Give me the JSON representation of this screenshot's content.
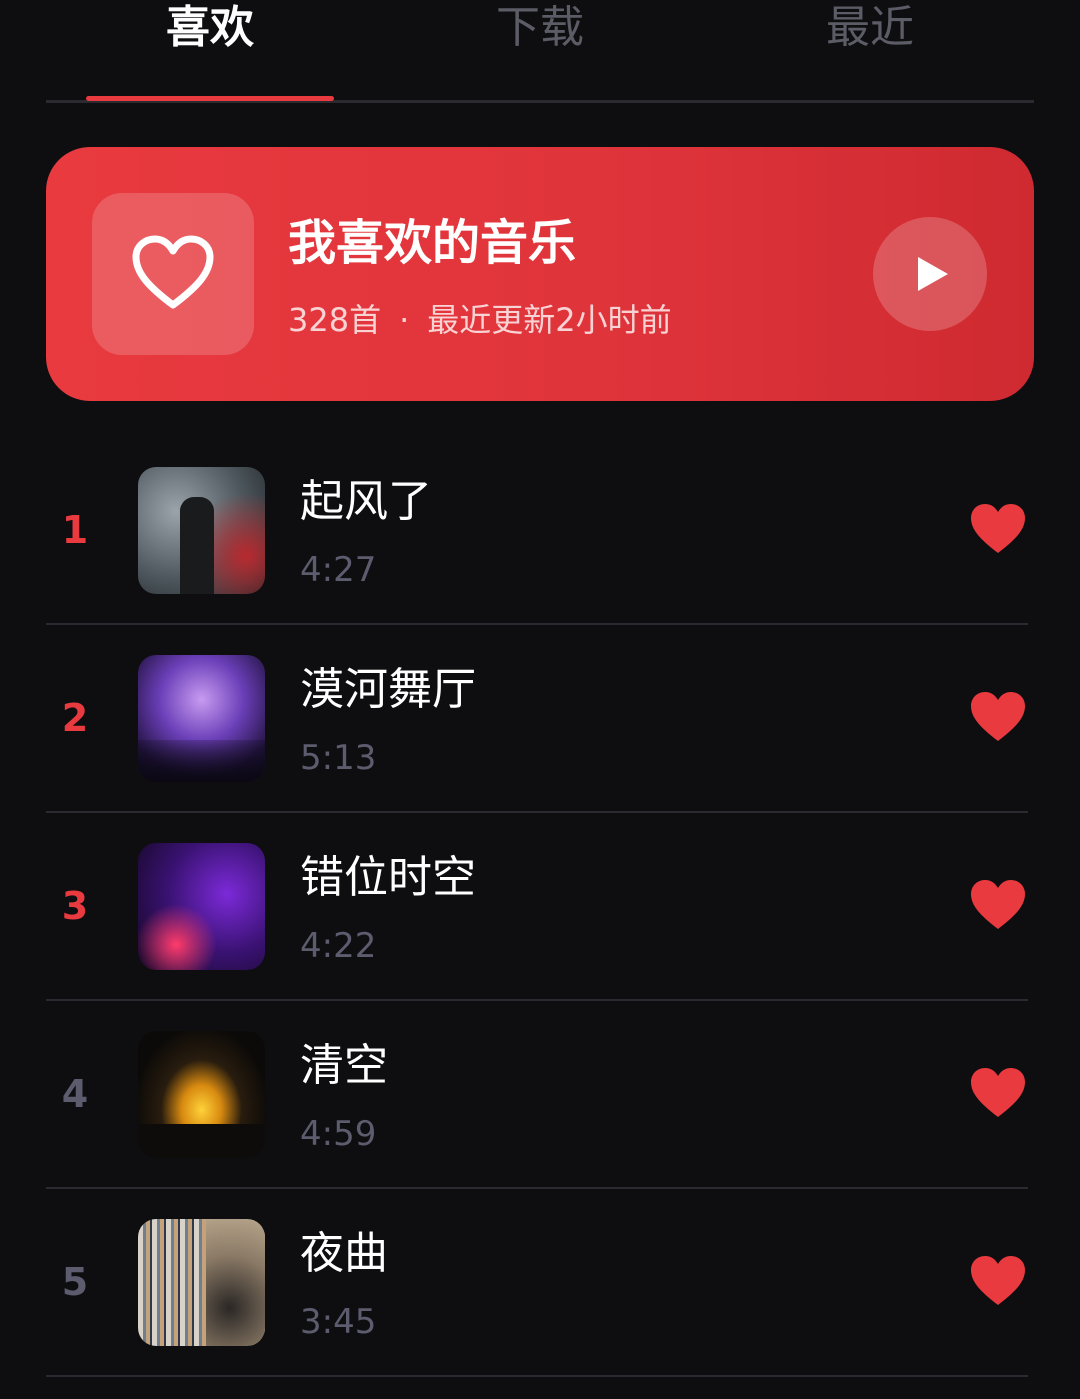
{
  "tabs": [
    {
      "label": "喜欢",
      "active": true
    },
    {
      "label": "下载",
      "active": false
    },
    {
      "label": "最近",
      "active": false
    }
  ],
  "hero": {
    "title": "我喜欢的音乐",
    "count": "328首",
    "separator": "·",
    "updated": "最近更新2小时前",
    "icon": "heart-outline-icon",
    "play_icon": "play-icon"
  },
  "songs": [
    {
      "rank": "1",
      "title": "起风了",
      "duration": "4:27",
      "liked": true
    },
    {
      "rank": "2",
      "title": "漠河舞厅",
      "duration": "5:13",
      "liked": true
    },
    {
      "rank": "3",
      "title": "错位时空",
      "duration": "4:22",
      "liked": true
    },
    {
      "rank": "4",
      "title": "清空",
      "duration": "4:59",
      "liked": true
    },
    {
      "rank": "5",
      "title": "夜曲",
      "duration": "3:45",
      "liked": true
    }
  ],
  "colors": {
    "accent": "#e83a3f",
    "background": "#0e0e11",
    "muted": "#5c5c6e"
  }
}
